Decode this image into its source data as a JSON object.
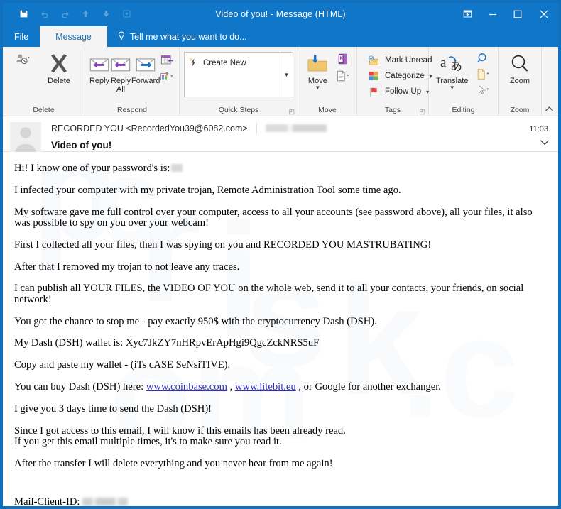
{
  "window": {
    "title": "Video of you! - Message (HTML)",
    "accent_color": "#1077c8",
    "border_color": "#1170be"
  },
  "quick_access_toolbar": {
    "items": [
      {
        "name": "save-icon",
        "label": "Save",
        "state": "enabled"
      },
      {
        "name": "undo-icon",
        "label": "Undo",
        "state": "disabled"
      },
      {
        "name": "redo-icon",
        "label": "Redo",
        "state": "disabled"
      },
      {
        "name": "previous-item-icon",
        "label": "Previous Item",
        "state": "disabled"
      },
      {
        "name": "next-item-icon",
        "label": "Next Item",
        "state": "disabled"
      },
      {
        "name": "customize-quick-access-toolbar-icon",
        "label": "Customize Quick Access Toolbar",
        "state": "disabled"
      }
    ]
  },
  "window_controls": {
    "help": "?",
    "restore_ribbon": "Ribbon Display Options",
    "minimize": "–",
    "maximize": "□",
    "close": "✕"
  },
  "tabs": {
    "file": "File",
    "message": "Message",
    "tellme": "Tell me what you want to do..."
  },
  "ribbon": {
    "groups": [
      {
        "label": "Delete",
        "buttons": [
          {
            "label": "Delete",
            "icon": "delete-x-icon"
          },
          {
            "label": "",
            "icon": "ignore-icon"
          }
        ]
      },
      {
        "label": "Respond",
        "buttons": [
          {
            "label": "Reply",
            "icon": "reply-icon"
          },
          {
            "label": "Reply\nAll",
            "icon": "reply-all-icon"
          },
          {
            "label": "Forward",
            "icon": "forward-icon"
          },
          {
            "label": "",
            "icon": "meeting-icon"
          },
          {
            "label": "",
            "icon": "more-respond-icon"
          }
        ]
      },
      {
        "label": "Quick Steps",
        "quick_step_item": "Create New",
        "has_dialog_launcher": true
      },
      {
        "label": "Move",
        "buttons": [
          {
            "label": "Move",
            "icon": "move-folder-icon"
          },
          {
            "label": "",
            "icon": "onenote-icon"
          },
          {
            "label": "",
            "icon": "rules-icon"
          }
        ]
      },
      {
        "label": "Tags",
        "has_dialog_launcher": true,
        "buttons": [
          {
            "label": "Mark Unread",
            "icon": "mark-unread-icon"
          },
          {
            "label": "Categorize",
            "icon": "categorize-icon"
          },
          {
            "label": "Follow Up",
            "icon": "follow-up-flag-icon"
          }
        ]
      },
      {
        "label": "Editing",
        "buttons": [
          {
            "label": "Translate",
            "icon": "translate-icon"
          },
          {
            "label": "",
            "icon": "find-icon"
          },
          {
            "label": "",
            "icon": "related-icon"
          },
          {
            "label": "",
            "icon": "select-icon"
          }
        ]
      },
      {
        "label": "Zoom",
        "buttons": [
          {
            "label": "Zoom",
            "icon": "zoom-magnifier-icon"
          }
        ]
      }
    ],
    "collapse_label": "Collapse the Ribbon"
  },
  "message_header": {
    "sender": "RECORDED YOU <RecordedYou39@6082.com>",
    "recipient_redacted": true,
    "subject": "Video of you!",
    "time": "11:03"
  },
  "message_body": {
    "paragraphs": [
      {
        "type": "text_with_redaction",
        "text": "Hi! I know one of your password's is:"
      },
      {
        "type": "text",
        "text": "I infected your computer with my private trojan, Remote Administration Tool some time ago."
      },
      {
        "type": "text",
        "text": "My software gave me full control over your computer, access to all your accounts (see password above), all your files, it also was possible to spy on you over your webcam!"
      },
      {
        "type": "text",
        "text": "First I collected all your files, then I was spying on you and RECORDED YOU MASTRUBATING!"
      },
      {
        "type": "text",
        "text": "After that I removed my trojan to not leave any traces."
      },
      {
        "type": "text",
        "text": "I can publish all YOUR FILES, the VIDEO OF YOU on the whole web, send it to all your contacts, your friends, on social network!"
      },
      {
        "type": "text",
        "text": "You got the chance to stop me - pay exactly 950$ with the cryptocurrency Dash (DSH)."
      },
      {
        "type": "text",
        "text": "My Dash (DSH) wallet is: Xyc7JkZY7nHRpvErApHgi9QgcZckNRS5uF"
      },
      {
        "type": "text",
        "text": "Copy and paste my wallet - (iTs cASE SeNsiTIVE)."
      },
      {
        "type": "links",
        "prefix": "You can buy Dash (DSH) here: ",
        "link1": "www.coinbase.com",
        "mid": " , ",
        "link2": "www.litebit.eu",
        "suffix": " , or Google for another exchanger."
      },
      {
        "type": "text",
        "text": "I give you 3 days time to send the Dash (DSH)!"
      },
      {
        "type": "text",
        "text": "Since I got access to this email, I will know if this emails has been already read."
      },
      {
        "type": "text",
        "text": "If you get this email multiple times, it's to make sure you read it."
      },
      {
        "type": "text",
        "text": "After the transfer I will delete everything and you never hear from me again!"
      },
      {
        "type": "text_with_redaction",
        "text": "Mail-Client-ID:"
      }
    ],
    "ransom_amount": "950$",
    "currency": "Dash (DSH)",
    "wallet_address": "Xyc7JkZY7nHRpvErApHgi9QgcZckNRS5uF",
    "deadline_days": "3",
    "link_color": "#2f2fc4"
  },
  "watermark": {
    "text": "pcrisk.com"
  }
}
